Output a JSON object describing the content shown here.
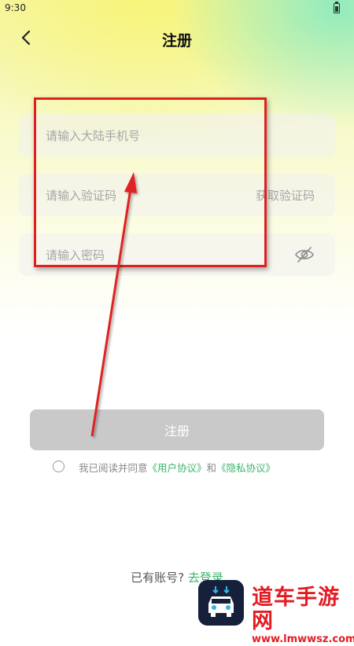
{
  "status_bar": {
    "time": "9:30"
  },
  "header": {
    "title": "注册"
  },
  "form": {
    "phone_placeholder": "请输入大陆手机号",
    "code_placeholder": "请输入验证码",
    "get_code_label": "获取验证码",
    "password_placeholder": "请输入密码"
  },
  "register_button": {
    "label": "注册"
  },
  "agreement": {
    "prefix": "我已阅读并同意",
    "user_agreement": "《用户协议》",
    "conjunction": "和",
    "privacy_agreement": "《隐私协议》"
  },
  "footer": {
    "has_account": "已有账号?",
    "login_link": "去登录"
  },
  "watermark": {
    "site_name": "道车手游网",
    "url": "www.lmwwsz.com"
  },
  "colors": {
    "accent_green": "#3cb56a",
    "button_disabled": "#c9c9c9",
    "annotation_red": "#e02020"
  },
  "icons": [
    "back-arrow-icon",
    "eye-closed-icon",
    "radio-icon",
    "battery-icon"
  ]
}
